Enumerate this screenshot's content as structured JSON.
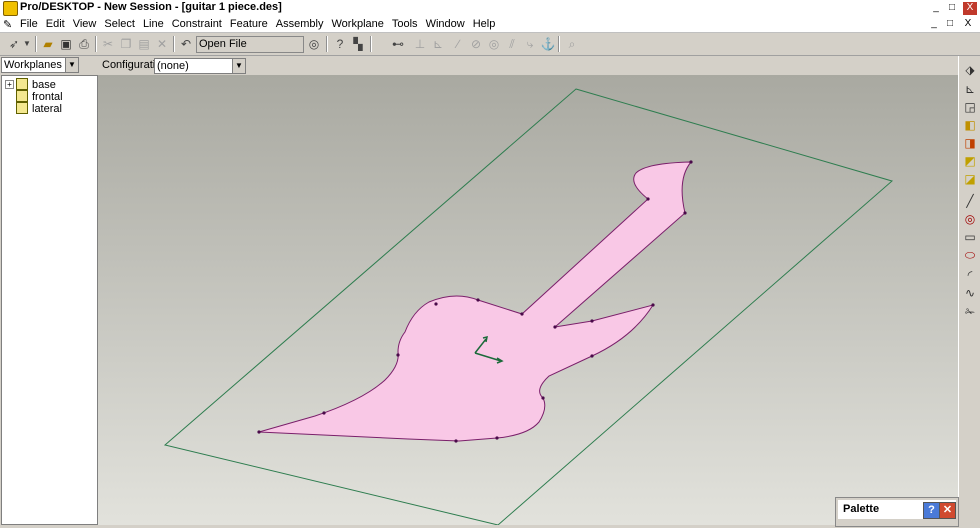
{
  "window": {
    "title": "Pro/DESKTOP - New Session - [guitar 1 piece.des]",
    "controls": [
      "_",
      "□",
      "X"
    ],
    "doc_controls": [
      "_",
      "□",
      "X"
    ]
  },
  "menu": [
    "File",
    "Edit",
    "View",
    "Select",
    "Line",
    "Constraint",
    "Feature",
    "Assembly",
    "Workplane",
    "Tools",
    "Window",
    "Help"
  ],
  "toolbar": {
    "open_file": "Open File"
  },
  "browser": {
    "selector": "Workplanes",
    "items": [
      "base",
      "frontal",
      "lateral"
    ]
  },
  "config": {
    "label": "Configuration:",
    "value": "(none)"
  },
  "palette": {
    "title": "Palette"
  },
  "colors": {
    "profile_fill": "#f9c8e6",
    "workplane_line": "#2e7d4f",
    "axis": "#1b6a3a"
  }
}
